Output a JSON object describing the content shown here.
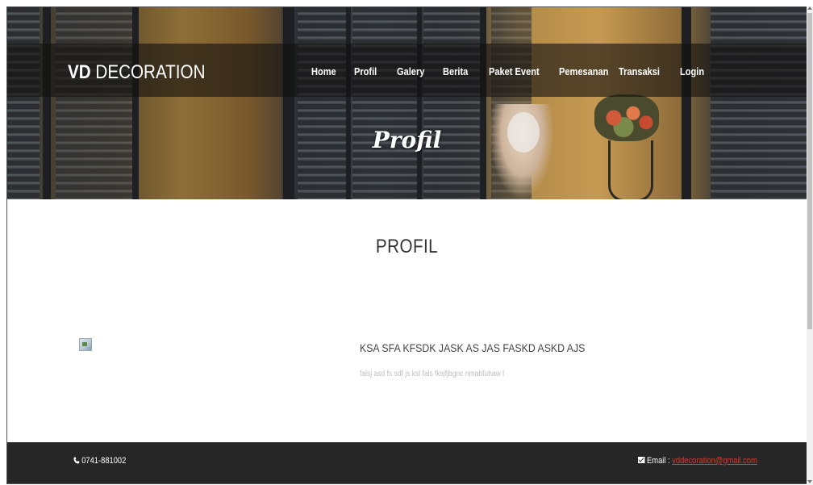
{
  "header": {
    "brand_bold": "VD",
    "brand_rest": " DECORATION",
    "nav": [
      {
        "label": "Home"
      },
      {
        "label": "Profil"
      },
      {
        "label": "Galery"
      },
      {
        "label": "Berita"
      },
      {
        "label": "Paket Event"
      },
      {
        "label": "Pemesanan"
      },
      {
        "label": "Transaksi"
      },
      {
        "label": "Login"
      }
    ],
    "hero_title": "Profil"
  },
  "main": {
    "section_title": "PROFIL",
    "heading": "KSA SFA KFSDK JASK AS JAS FASKD ASKD AJS",
    "text": "falsj asd fs sdf js ksl fals fksjfjbgnc nmabfuhaw l"
  },
  "footer": {
    "phone": "0741-881002",
    "email_label": "Email : ",
    "email": "vddecoration@gmail.com"
  },
  "icons": {
    "phone": "phone-icon",
    "email": "envelope-icon",
    "image": "broken-image-icon"
  },
  "colors": {
    "footer_bg": "#262626",
    "email_link": "#e0392b",
    "muted_text": "#bdbdbd"
  }
}
